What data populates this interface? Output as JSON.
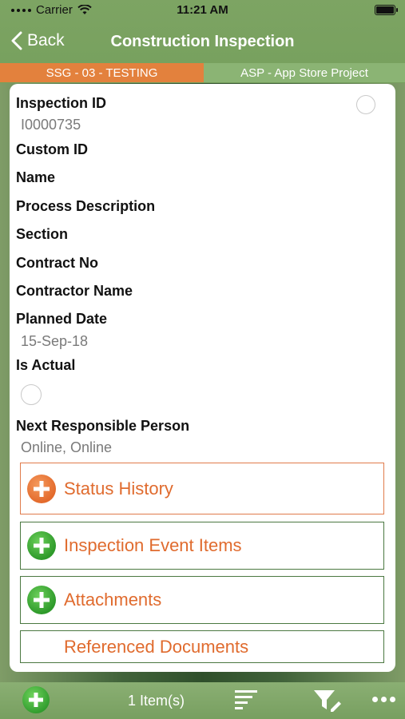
{
  "status_bar": {
    "carrier": "Carrier",
    "time": "11:21 AM"
  },
  "nav": {
    "back_label": "Back",
    "title": "Construction Inspection"
  },
  "project": {
    "left": "SSG - 03 - TESTING",
    "right": "ASP - App Store Project"
  },
  "fields": {
    "inspection_id_label": "Inspection ID",
    "inspection_id_value": "I0000735",
    "custom_id_label": "Custom ID",
    "name_label": "Name",
    "process_description_label": "Process Description",
    "section_label": "Section",
    "contract_no_label": "Contract No",
    "contractor_name_label": "Contractor Name",
    "planned_date_label": "Planned Date",
    "planned_date_value": "15-Sep-18",
    "is_actual_label": "Is Actual",
    "next_responsible_label": "Next Responsible Person",
    "next_responsible_value": "Online, Online"
  },
  "sections": {
    "status_history": "Status History",
    "inspection_event_items": "Inspection Event Items",
    "attachments": "Attachments",
    "referenced_documents": "Referenced Documents"
  },
  "toolbar": {
    "count_label": "1 Item(s)"
  },
  "colors": {
    "accent_orange": "#e06b2e",
    "nav_green": "#78a05e",
    "border_green": "#4b7841"
  }
}
